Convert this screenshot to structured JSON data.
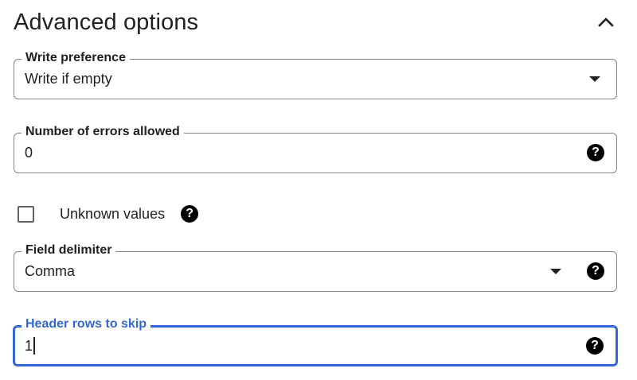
{
  "section": {
    "title": "Advanced options",
    "collapse_icon": "chevron-up-icon"
  },
  "write_preference": {
    "label": "Write preference",
    "value": "Write if empty",
    "icon": "dropdown-arrow-icon"
  },
  "errors_allowed": {
    "label": "Number of errors allowed",
    "value": "0",
    "help_icon": "help-icon"
  },
  "unknown_values": {
    "label": "Unknown values",
    "checked": false,
    "help_icon": "help-icon"
  },
  "field_delimiter": {
    "label": "Field delimiter",
    "value": "Comma",
    "icon": "dropdown-arrow-icon",
    "help_icon": "help-icon"
  },
  "header_rows": {
    "label": "Header rows to skip",
    "value": "1",
    "focused": true,
    "help_icon": "help-icon"
  },
  "colors": {
    "focus_accent": "#3367d6",
    "border": "#80868b",
    "text": "#202124"
  },
  "help_glyph": "?"
}
